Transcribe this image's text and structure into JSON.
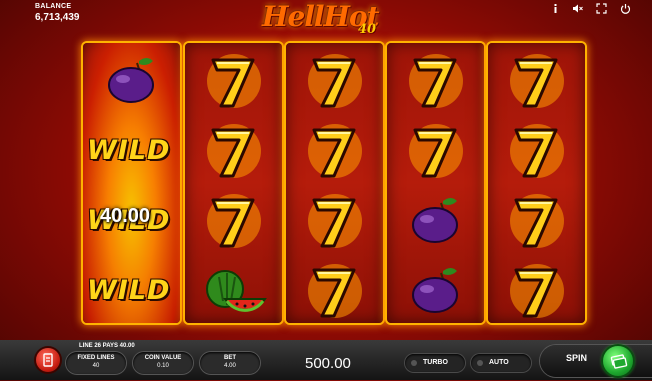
{
  "header": {
    "balance_label": "BALANCE",
    "balance_value": "6,713,439",
    "logo_line1": "HellHot",
    "logo_line2": "40",
    "icons": [
      "info-icon",
      "sound-muted-icon",
      "fullscreen-icon",
      "power-icon"
    ]
  },
  "reels": [
    [
      "plum",
      "wild",
      "wild",
      "wild"
    ],
    [
      "seven",
      "seven",
      "seven",
      "watermelon"
    ],
    [
      "seven",
      "seven",
      "seven",
      "seven"
    ],
    [
      "seven",
      "seven",
      "plum",
      "plum"
    ],
    [
      "seven",
      "seven",
      "seven",
      "seven"
    ]
  ],
  "wild_label": "WILD",
  "win_amount": "40.00",
  "footer": {
    "line_info": "LINE 26 PAYS 40.00",
    "fixed_lines_label": "FIXED LINES",
    "fixed_lines_value": "40",
    "coin_value_label": "COIN VALUE",
    "coin_value_value": "0.10",
    "bet_label": "BET",
    "bet_value": "4.00",
    "total_value": "500.00",
    "turbo_label": "TURBO",
    "auto_label": "AUTO",
    "spin_label": "SPIN"
  }
}
